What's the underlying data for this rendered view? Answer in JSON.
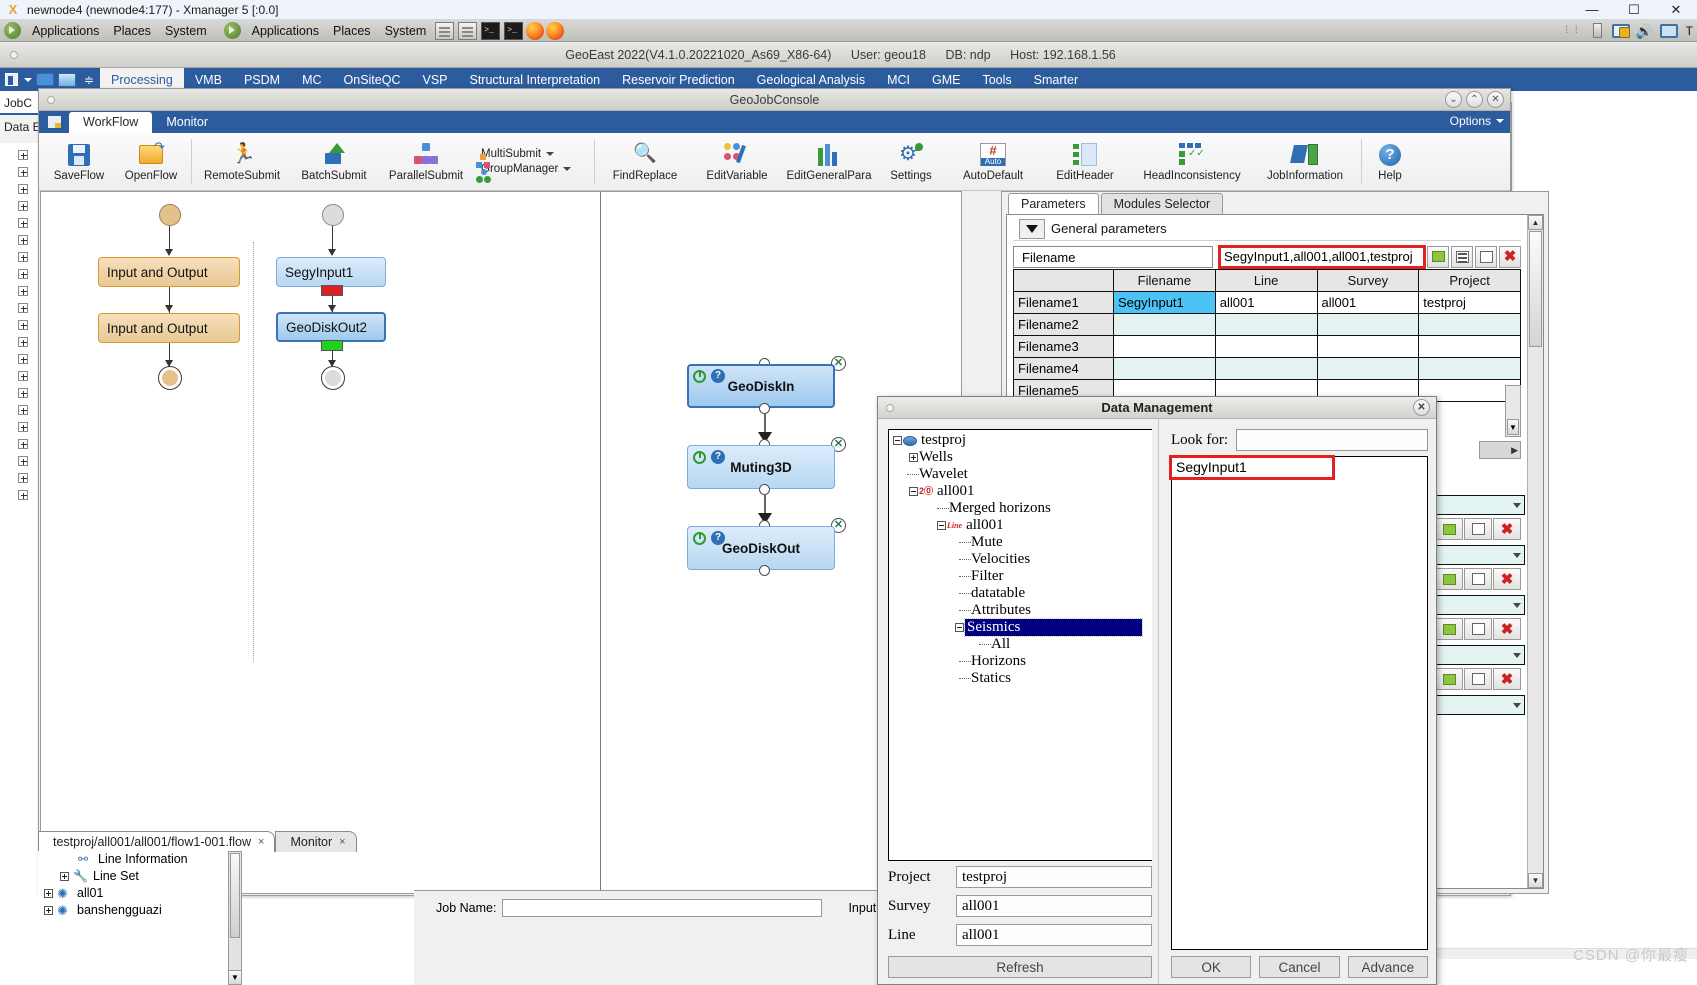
{
  "xmanager": {
    "title": "newnode4 (newnode4:177) - Xmanager 5 [:0.0]",
    "icon": "xmanager-icon",
    "minimize": "—",
    "maximize": "☐",
    "close": "✕"
  },
  "gnome_panel": {
    "menus_1": [
      "Applications",
      "Places",
      "System"
    ],
    "menus_2": [
      "Applications",
      "Places",
      "System"
    ],
    "tray_time": "T"
  },
  "app_header": {
    "version": "GeoEast 2022(V4.1.0.20221020_As69_X86-64)",
    "user": "User: geou18",
    "db": "DB: ndp",
    "host": "Host: 192.168.1.56"
  },
  "menubar": {
    "items": [
      {
        "label": "Processing",
        "active": true
      },
      {
        "label": "VMB",
        "active": false
      },
      {
        "label": "PSDM",
        "active": false
      },
      {
        "label": "MC",
        "active": false
      },
      {
        "label": "OnSiteQC",
        "active": false
      },
      {
        "label": "VSP",
        "active": false
      },
      {
        "label": "Structural Interpretation",
        "active": false
      },
      {
        "label": "Reservoir Prediction",
        "active": false
      },
      {
        "label": "Geological Analysis",
        "active": false
      },
      {
        "label": "MCI",
        "active": false
      },
      {
        "label": "GME",
        "active": false
      },
      {
        "label": "Tools",
        "active": false
      },
      {
        "label": "Smarter",
        "active": false
      }
    ]
  },
  "left_panel": {
    "tab_job": "JobC",
    "tab_data": "Data E"
  },
  "console": {
    "title": "GeoJobConsole",
    "tabs": [
      {
        "label": "WorkFlow",
        "active": true
      },
      {
        "label": "Monitor",
        "active": false
      }
    ],
    "options_label": "Options",
    "win_buttons": [
      "⌄",
      "⌃",
      "✕"
    ],
    "ribbon": [
      {
        "label": "SaveFlow",
        "icon": "save-icon"
      },
      {
        "label": "OpenFlow",
        "icon": "open-folder-icon"
      },
      {
        "label": "RemoteSubmit",
        "icon": "running-person-icon"
      },
      {
        "label": "BatchSubmit",
        "icon": "upload-arrow-icon"
      },
      {
        "label": "ParallelSubmit",
        "icon": "parallel-nodes-icon"
      },
      {
        "label": "MultiSubmit",
        "icon": "multi-submit-icon"
      },
      {
        "label": "GroupManager",
        "icon": "group-manager-icon"
      },
      {
        "label": "FindReplace",
        "icon": "magnifier-icon"
      },
      {
        "label": "EditVariable",
        "icon": "edit-variable-icon"
      },
      {
        "label": "EditGeneralPara",
        "icon": "edit-general-para-icon"
      },
      {
        "label": "Settings",
        "icon": "gear-icon"
      },
      {
        "label": "AutoDefault",
        "icon": "auto-default-icon"
      },
      {
        "label": "EditHeader",
        "icon": "edit-header-icon"
      },
      {
        "label": "HeadInconsistency",
        "icon": "head-inconsistency-icon"
      },
      {
        "label": "JobInformation",
        "icon": "job-information-icon"
      },
      {
        "label": "Help",
        "icon": "help-icon"
      }
    ]
  },
  "workflow": {
    "left_column": {
      "nodes": [
        {
          "label": "Input and Output"
        },
        {
          "label": "Input and Output"
        }
      ]
    },
    "middle_column": {
      "nodes": [
        {
          "label": "SegyInput1",
          "chip": "#e02020"
        },
        {
          "label": "GeoDiskOut2",
          "chip": "#22d022"
        }
      ]
    },
    "right_column": {
      "nodes": [
        {
          "label": "GeoDiskIn"
        },
        {
          "label": "Muting3D"
        },
        {
          "label": "GeoDiskOut"
        }
      ]
    }
  },
  "flow_tabs": [
    {
      "label": "testproj/all001/all001/flow1-001.flow",
      "close": "×",
      "active": true
    },
    {
      "label": "Monitor",
      "close": "×",
      "active": false
    }
  ],
  "parameters": {
    "tabs": [
      {
        "label": "Parameters",
        "active": true
      },
      {
        "label": "Modules Selector",
        "active": false
      }
    ],
    "section_title": "General parameters",
    "filename_label": "Filename",
    "filename_value": "SegyInput1,all001,all001,testproj",
    "buttons": [
      "pick-green-icon",
      "list-icon",
      "grid-icon",
      "delete-icon"
    ],
    "table": {
      "headers": [
        "",
        "Filename",
        "Line",
        "Survey",
        "Project"
      ],
      "rows": [
        {
          "name": "Filename1",
          "filename": "SegyInput1",
          "line": "all001",
          "survey": "all001",
          "project": "testproj",
          "selected": true
        },
        {
          "name": "Filename2",
          "filename": "",
          "line": "",
          "survey": "",
          "project": "",
          "selected": false
        },
        {
          "name": "Filename3",
          "filename": "",
          "line": "",
          "survey": "",
          "project": "",
          "selected": false
        },
        {
          "name": "Filename4",
          "filename": "",
          "line": "",
          "survey": "",
          "project": "",
          "selected": false
        },
        {
          "name": "Filename5",
          "filename": "",
          "line": "",
          "survey": "",
          "project": "",
          "selected": false
        }
      ]
    }
  },
  "data_management": {
    "title": "Data Management",
    "close": "✕",
    "tree": [
      {
        "label": "testproj",
        "depth": 0,
        "toggle": "minus",
        "icon": "project-icon",
        "selected": false
      },
      {
        "label": "Wells",
        "depth": 1,
        "toggle": "plus",
        "icon": "none",
        "selected": false
      },
      {
        "label": "Wavelet",
        "depth": 1,
        "toggle": "leaf",
        "icon": "none",
        "selected": false
      },
      {
        "label": "all001",
        "depth": 1,
        "toggle": "minus",
        "icon": "2d-icon",
        "selected": false
      },
      {
        "label": "Merged horizons",
        "depth": 2,
        "toggle": "leaf",
        "icon": "none",
        "selected": false
      },
      {
        "label": "all001",
        "depth": 2,
        "toggle": "minus",
        "icon": "line-icon",
        "selected": false
      },
      {
        "label": "Mute",
        "depth": 3,
        "toggle": "leaf",
        "icon": "none",
        "selected": false
      },
      {
        "label": "Velocities",
        "depth": 3,
        "toggle": "leaf",
        "icon": "none",
        "selected": false
      },
      {
        "label": "Filter",
        "depth": 3,
        "toggle": "leaf",
        "icon": "none",
        "selected": false
      },
      {
        "label": "datatable",
        "depth": 3,
        "toggle": "leaf",
        "icon": "none",
        "selected": false
      },
      {
        "label": "Attributes",
        "depth": 3,
        "toggle": "leaf",
        "icon": "none",
        "selected": false
      },
      {
        "label": "Seismics",
        "depth": 3,
        "toggle": "minus",
        "icon": "none",
        "selected": true
      },
      {
        "label": "All",
        "depth": 4,
        "toggle": "leaf",
        "icon": "none",
        "selected": false
      },
      {
        "label": "Horizons",
        "depth": 3,
        "toggle": "leaf",
        "icon": "none",
        "selected": false
      },
      {
        "label": "Statics",
        "depth": 3,
        "toggle": "leaf",
        "icon": "none",
        "selected": false
      }
    ],
    "fields": [
      {
        "label": "Project",
        "value": "testproj"
      },
      {
        "label": "Survey",
        "value": "all001"
      },
      {
        "label": "Line",
        "value": "all001"
      }
    ],
    "refresh_label": "Refresh",
    "look_for_label": "Look for:",
    "look_for_value": "",
    "list_items": [
      {
        "label": "SegyInput1",
        "highlighted": true
      }
    ],
    "ok_label": "OK",
    "cancel_label": "Cancel",
    "advance_label": "Advance"
  },
  "bottom_tree": [
    {
      "label": "Line Information",
      "icon": "network-icon",
      "toggle": "leaf",
      "depth": 2
    },
    {
      "label": "Line Set",
      "icon": "wrench-icon",
      "toggle": "plus",
      "depth": 2
    },
    {
      "label": "all01",
      "icon": "seismic-icon",
      "toggle": "plus",
      "depth": 1
    },
    {
      "label": "banshengguazi",
      "icon": "seismic-icon",
      "toggle": "plus",
      "depth": 1
    }
  ],
  "job_bar": {
    "job_name_label": "Job Name:",
    "job_name_value": "",
    "input_label": "Input:"
  },
  "watermark": "CSDN @你最瘦",
  "colors": {
    "menubar_blue": "#2c5c9e",
    "selection_blue": "#4cc3f5",
    "tree_selection": "#000080",
    "highlight_red": "#e32121",
    "chip_red": "#e02020",
    "chip_green": "#22d022"
  }
}
